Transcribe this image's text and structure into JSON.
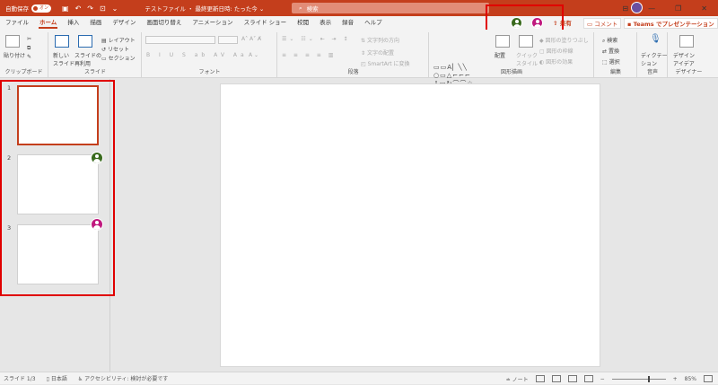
{
  "titlebar": {
    "autosave_label": "自動保存",
    "autosave_state": "オン",
    "doc_title": "テストファイル ・ 最終更新日時: たった今 ⌄",
    "search_placeholder": "検索"
  },
  "tabs": [
    "ファイル",
    "ホーム",
    "挿入",
    "描画",
    "デザイン",
    "画面切り替え",
    "アニメーション",
    "スライド ショー",
    "校閲",
    "表示",
    "録音",
    "ヘルプ"
  ],
  "active_tab": "ホーム",
  "header_actions": {
    "share": "共有",
    "comment": "コメント",
    "teams": "Teams でプレゼンテーション"
  },
  "collaborators": [
    {
      "name": "collaborator-1",
      "color": "#3a6b1e"
    },
    {
      "name": "collaborator-2",
      "color": "#c0187e"
    }
  ],
  "ribbon": {
    "clipboard": {
      "label": "クリップボード",
      "paste": "貼り付け"
    },
    "slides": {
      "label": "スライド",
      "new_slide": "新しい\nスライド",
      "reuse": "スライドの\n再利用",
      "layout": "レイアウト",
      "reset": "リセット",
      "section": "セクション"
    },
    "font": {
      "label": "フォント"
    },
    "paragraph": {
      "label": "段落",
      "text_direction": "文字列の方向",
      "align_text": "文字の配置",
      "smartart": "SmartArt に変換"
    },
    "drawing": {
      "label": "図形描画",
      "arrange": "配置",
      "quick_styles": "クイック\nスタイル",
      "fill": "図形の塗りつぶし",
      "outline": "図形の枠線",
      "effects": "図形の効果"
    },
    "editing": {
      "label": "編集",
      "find": "検索",
      "replace": "置換",
      "select": "選択"
    },
    "voice": {
      "label": "音声",
      "dictate": "ディクテー\nション"
    },
    "designer": {
      "label": "デザイナー",
      "design_ideas": "デザイン\nアイデア"
    }
  },
  "slides": [
    {
      "number": "1",
      "selected": true,
      "collaborator": null
    },
    {
      "number": "2",
      "selected": false,
      "collaborator": "#3a6b1e"
    },
    {
      "number": "3",
      "selected": false,
      "collaborator": "#c0187e"
    }
  ],
  "status": {
    "slide_count": "スライド 1/3",
    "language": "日本語",
    "accessibility": "アクセシビリティ: 検討が必要です",
    "notes": "ノート",
    "zoom": "85%"
  }
}
